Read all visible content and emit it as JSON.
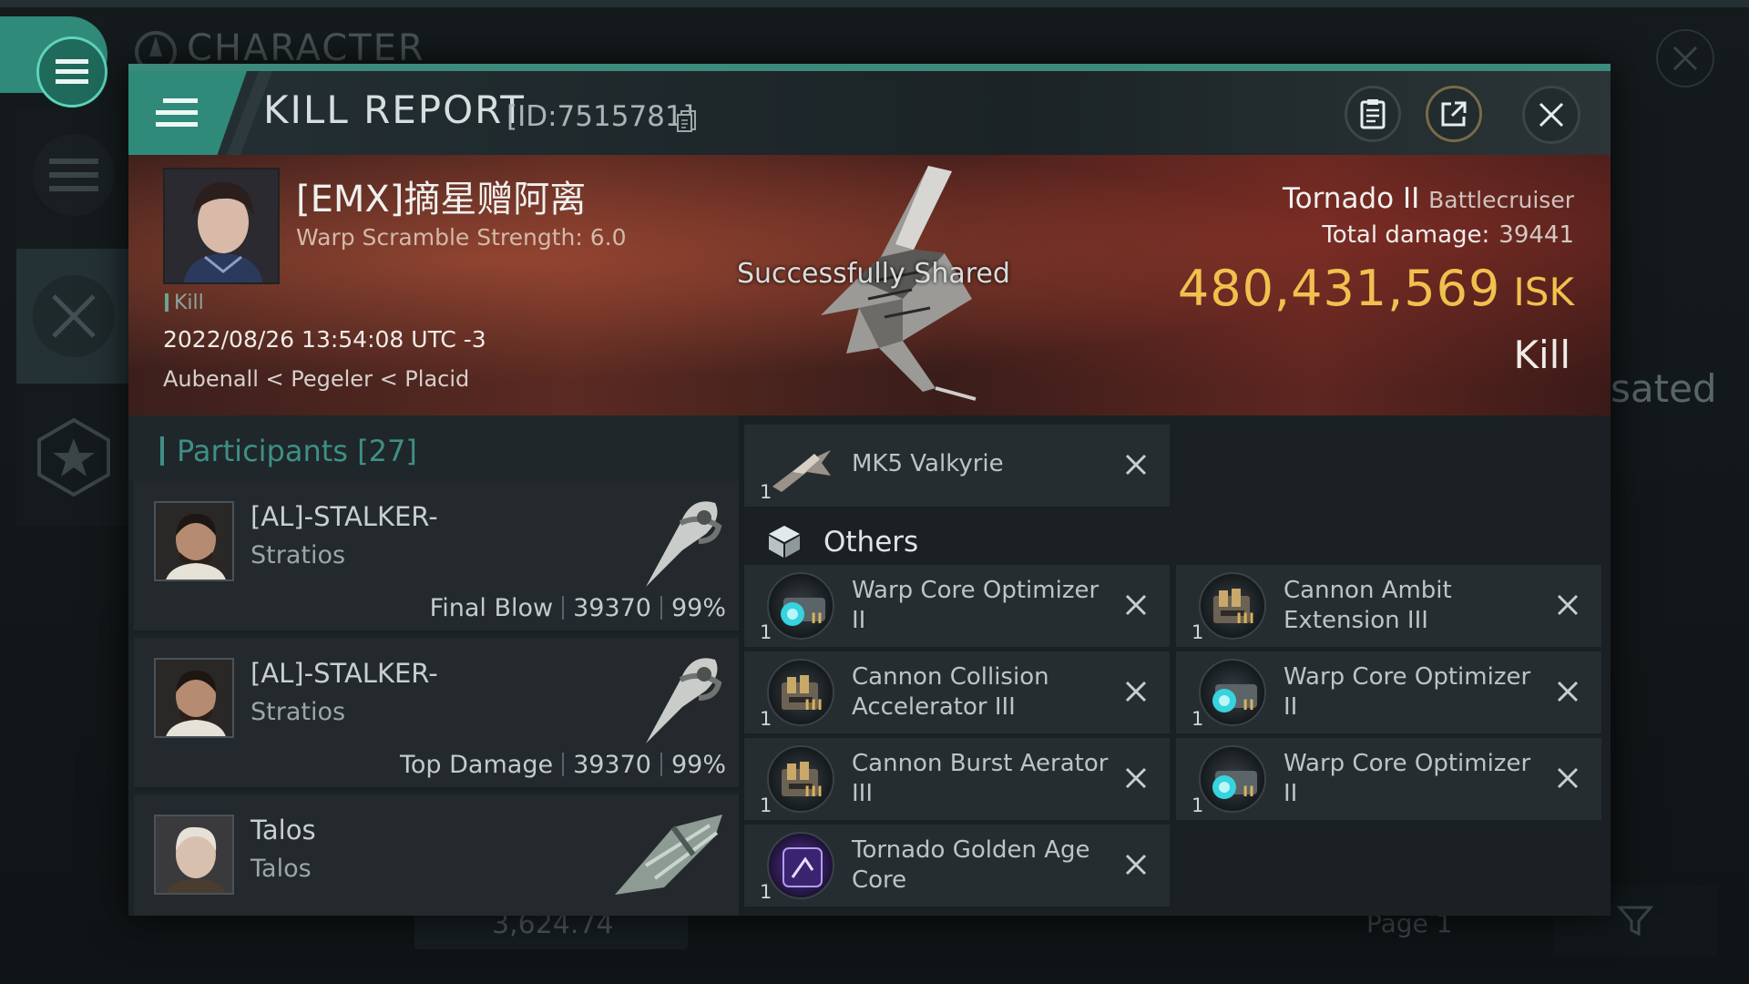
{
  "background": {
    "title": "CHARACTER",
    "partial_text": "sated",
    "bottom_value": "3,624.74",
    "bottom_page": "Page 1"
  },
  "modal": {
    "title": "KILL REPORT",
    "id_text": "[ID:7515781]",
    "icons": {
      "menu": "hamburger-menu-icon",
      "copy": "copy-icon",
      "report": "clipboard-icon",
      "share": "share-external-icon",
      "close": "close-icon"
    }
  },
  "victim": {
    "name": "[EMX]摘星赠阿离",
    "warp_scramble": "Warp Scramble Strength: 6.0",
    "tag": "Kill",
    "date": "2022/08/26 13:54:08 UTC -3",
    "location": "Aubenall < Pegeler < Placid",
    "ship_name": "Tornado II",
    "ship_class": "Battlecruiser",
    "total_damage_label": "Total damage:",
    "total_damage": "39441",
    "isk_value": "480,431,569",
    "isk_unit": "ISK",
    "result": "Kill",
    "toast": "Successfully Shared"
  },
  "participants": {
    "title": "Participants",
    "count": "[27]",
    "rows": [
      {
        "name": "[AL]-STALKER-",
        "ship": "Stratios",
        "role": "Final Blow",
        "damage": "39370",
        "percent": "99%"
      },
      {
        "name": "[AL]-STALKER-",
        "ship": "Stratios",
        "role": "Top Damage",
        "damage": "39370",
        "percent": "99%"
      },
      {
        "name": "Talos",
        "ship": "Talos",
        "role": "",
        "damage": "",
        "percent": ""
      }
    ]
  },
  "items": {
    "drone": {
      "name": "MK5  Valkyrie",
      "qty": "1"
    },
    "others_label": "Others",
    "list": [
      {
        "name": "Warp Core Optimizer II",
        "qty": "1",
        "tier": "II",
        "icon": "warp-core-optimizer-icon"
      },
      {
        "name": "Cannon Ambit Extension III",
        "qty": "1",
        "tier": "III",
        "icon": "cannon-rig-icon"
      },
      {
        "name": "Cannon Collision Accelerator III",
        "qty": "1",
        "tier": "III",
        "icon": "cannon-rig-icon"
      },
      {
        "name": "Warp Core Optimizer II",
        "qty": "1",
        "tier": "II",
        "icon": "warp-core-optimizer-icon"
      },
      {
        "name": "Cannon Burst Aerator III",
        "qty": "1",
        "tier": "III",
        "icon": "cannon-rig-icon"
      },
      {
        "name": "Warp Core Optimizer II",
        "qty": "1",
        "tier": "II",
        "icon": "warp-core-optimizer-icon"
      },
      {
        "name": "Tornado Golden Age Core",
        "qty": "1",
        "tier": "",
        "icon": "golden-age-core-icon"
      }
    ]
  },
  "colors": {
    "accent": "#2f8a79",
    "isk": "#f0c14e",
    "banner": "#5a2a22"
  }
}
